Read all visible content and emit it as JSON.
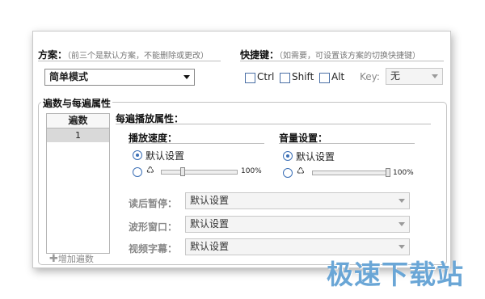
{
  "scheme": {
    "label": "方案：",
    "hint": "（前三个是默认方案，不能删除或更改）",
    "selected": "简单模式"
  },
  "hotkey": {
    "label": "快捷键：",
    "hint": "（如需要，可设置该方案的切换快捷键）",
    "ctrl": "Ctrl",
    "shift": "Shift",
    "alt": "Alt",
    "key_label": "Key:",
    "key_value": "无"
  },
  "loops": {
    "group_label": "遍数与每遍属性",
    "list_header": "遍数",
    "rows": [
      "1"
    ],
    "add_label": "增加遍数"
  },
  "per_pass": {
    "label": "每遍播放属性：",
    "speed": {
      "label": "播放速度：",
      "default_option": "默认设置",
      "percent_label": "100%",
      "slider_fraction": 0.26
    },
    "volume": {
      "label": "音量设置：",
      "default_option": "默认设置",
      "percent_label": "100%",
      "slider_fraction": 1.0
    },
    "pause": {
      "label": "读后暂停：",
      "value": "默认设置"
    },
    "waveform": {
      "label": "波形窗口：",
      "value": "默认设置"
    },
    "subtitle": {
      "label": "视频字幕：",
      "value": "默认设置"
    }
  },
  "watermark": "极速下载站",
  "colors": {
    "accent": "#3b6fb6",
    "watermark": "#6aa6d6"
  }
}
